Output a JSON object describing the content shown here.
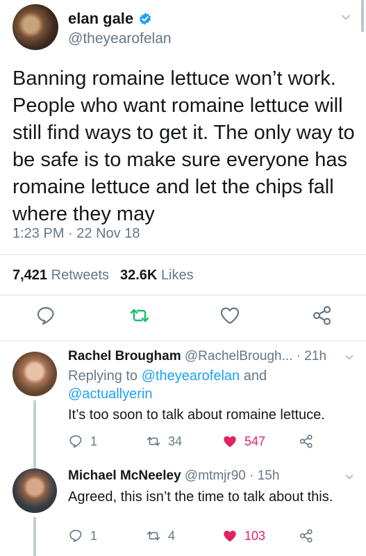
{
  "tweet": {
    "author_name": "elan gale",
    "author_handle": "@theyearofelan",
    "text": "Banning romaine lettuce won’t work. People who want romaine lettuce will still find ways to get it. The only way to be safe is to make sure everyone has romaine lettuce and let the chips fall where they may",
    "time": "1:23 PM",
    "date": "22 Nov 18",
    "separator": "·",
    "retweets_count": "7,421",
    "retweets_label": "Retweets",
    "likes_count": "32.6K",
    "likes_label": "Likes"
  },
  "replies": [
    {
      "name": "Rachel Brougham",
      "handle": "@RachelBrough...",
      "age": "· 21h",
      "replying_prefix": "Replying to",
      "replying_to_1": "@theyearofelan",
      "replying_and": "and",
      "replying_to_2": "@actuallyerin",
      "text": "It’s too soon to talk about romaine lettuce.",
      "reply_count": "1",
      "retweet_count": "34",
      "like_count": "547"
    },
    {
      "name": "Michael McNeeley",
      "handle": "@mtmjr90",
      "age": "· 15h",
      "text": "Agreed, this isn’t the time to talk about this.",
      "reply_count": "1",
      "retweet_count": "4",
      "like_count": "103"
    }
  ],
  "colors": {
    "brand_blue": "#1da1f2",
    "retweet_green": "#17bf63",
    "like_red": "#e0245e",
    "muted_grey": "#657786"
  }
}
